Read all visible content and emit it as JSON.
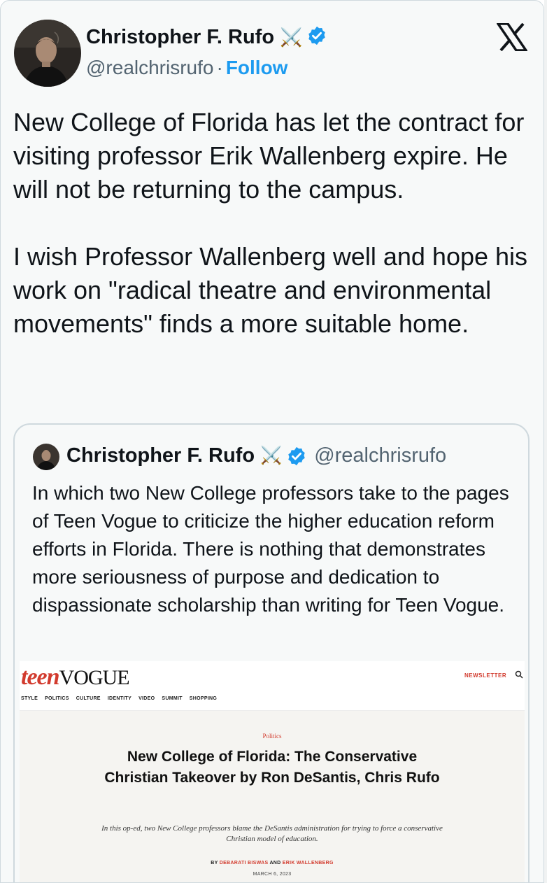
{
  "author": {
    "name": "Christopher F. Rufo",
    "emoji": "⚔️",
    "handle": "@realchrisrufo",
    "separator": "·",
    "follow_label": "Follow"
  },
  "tweet": {
    "text": "New College of Florida has let the contract for visiting professor Erik Wallenberg expire. He will not be returning to the campus.\n\nI wish Professor Wallenberg well and hope his work on \"radical theatre and environmental movements\" finds a more suitable home."
  },
  "quoted": {
    "name": "Christopher F. Rufo",
    "emoji": "⚔️",
    "handle": "@realchrisrufo",
    "text": "In which two New College professors take to the pages of Teen Vogue to criticize the higher education reform efforts in Florida. There is nothing that demonstrates more seriousness of purpose and dedication to dispassionate scholarship than writing for Teen Vogue."
  },
  "article": {
    "logo_teen": "teen",
    "logo_vogue": "VOGUE",
    "newsletter": "NEWSLETTER",
    "nav": [
      "STYLE",
      "POLITICS",
      "CULTURE",
      "IDENTITY",
      "VIDEO",
      "SUMMIT",
      "SHOPPING"
    ],
    "section": "Politics",
    "headline": "New College of Florida: The Conservative Christian Takeover by Ron DeSantis, Chris Rufo",
    "dek": "In this op-ed, two New College professors blame the DeSantis administration for trying to force a conservative Christian model of education.",
    "byline_prefix": "BY",
    "author1": "DEBARATI BISWAS",
    "byline_and": "AND",
    "author2": "ERIK WALLENBERG",
    "date": "MARCH 6, 2023"
  },
  "colors": {
    "accent_blue": "#1d9bf0",
    "teen_vogue_red": "#d23b2e",
    "card_background": "#f7f9f9",
    "secondary_text": "#536471"
  },
  "icons": [
    "x-logo-icon",
    "verified-badge-icon",
    "search-icon"
  ]
}
